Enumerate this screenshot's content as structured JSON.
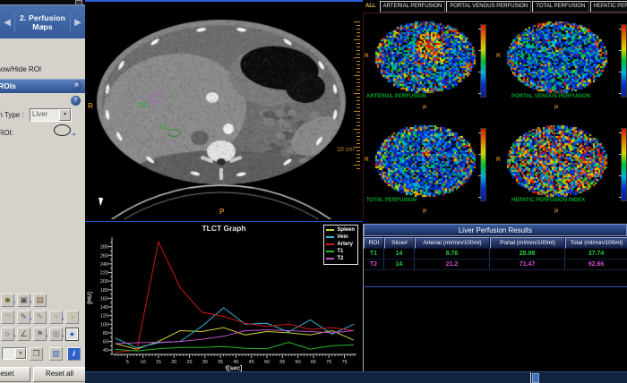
{
  "sidebar": {
    "nav_banner": {
      "title": "2. Perfusion Maps",
      "prev_icon": "◄",
      "next_icon": "►",
      "dropdown_icon": "▼"
    },
    "show_hide_roi_label": "Show/Hide ROI",
    "rois_panel": {
      "title": "ROIs",
      "close_icon": "✕",
      "help_icon": "?",
      "type_label": "Perfusion Type :",
      "type_value": "Liver",
      "tissue_roi_label": "Tissue ROI:"
    },
    "toolbar": {
      "rows": [
        {
          "icons": [
            {
              "name": "protocol-user-icon",
              "glyph": "☻",
              "color": "#6a6f2a",
              "dropdown": true
            },
            {
              "name": "copy-series-icon",
              "glyph": "▣",
              "color": "#555555",
              "dropdown": true
            },
            {
              "name": "report-notebook-icon",
              "glyph": "▤",
              "color": "#7a5a2a",
              "dropdown": false
            }
          ]
        },
        {
          "icons": [
            {
              "name": "tooth-roi-icon",
              "glyph": "◠",
              "color": "#777777",
              "dropdown": false
            },
            {
              "name": "freehand-draw-icon",
              "glyph": "✎",
              "color": "#555555",
              "dropdown": true
            },
            {
              "name": "pencil-roi-icon",
              "glyph": "✎",
              "color": "#888888",
              "dropdown": false
            },
            {
              "name": "seed-point-icon",
              "glyph": "+",
              "color": "#999999",
              "dropdown": true
            },
            {
              "name": "bean-roi-icon",
              "glyph": "◗",
              "color": "#b8a23a",
              "dropdown": false
            }
          ]
        },
        {
          "icons": [
            {
              "name": "circle-roi-icon",
              "glyph": "○",
              "color": "#444444",
              "dropdown": true
            },
            {
              "name": "angle-measure-icon",
              "glyph": "∠",
              "color": "#555555",
              "dropdown": false
            },
            {
              "name": "flag-annotation-icon",
              "glyph": "⚑",
              "color": "#777777",
              "dropdown": true
            },
            {
              "name": "magnify-roi-icon",
              "glyph": "◎",
              "color": "#666666",
              "dropdown": true
            },
            {
              "name": "ellipse-roi-tool-icon",
              "glyph": "●",
              "color": "#2f62c8",
              "active": true,
              "dropdown": false
            }
          ]
        }
      ],
      "combo_row": {
        "combo_dropdown_icon": "▼",
        "copy_icon": "❐",
        "grid_icon": "▥",
        "info_icon": "i"
      }
    },
    "reset_button": "Reset",
    "reset_all_button": "Reset all"
  },
  "ct_view": {
    "orientation_left": "R",
    "orientation_bottom": "P",
    "scale_label": "10 cm",
    "rois": [
      {
        "id": "T1",
        "label": "T1",
        "color": "#2f8e2f"
      },
      {
        "id": "T2",
        "label": "T2",
        "color": "#b05ec0"
      }
    ]
  },
  "maps_panel": {
    "tabs": [
      {
        "label": "ALL",
        "active": true
      },
      {
        "label": "ARTERIAL PERFUSION",
        "active": false
      },
      {
        "label": "PORTAL VENOUS PERFUSION",
        "active": false
      },
      {
        "label": "TOTAL PERFUSION",
        "active": false
      },
      {
        "label": "HEPATIC PERFUSION INDEX",
        "active": false
      }
    ],
    "maps": [
      {
        "id": "arterial",
        "label": "ARTERIAL PERFUSION",
        "orientation_left": "R",
        "orientation_bottom": "P"
      },
      {
        "id": "portal",
        "label": "PORTAL VENOUS PERFUSION",
        "orientation_left": "R",
        "orientation_bottom": "P"
      },
      {
        "id": "total",
        "label": "TOTAL PERFUSION",
        "orientation_left": "R",
        "orientation_bottom": "P"
      },
      {
        "id": "hepatic",
        "label": "HEPATIC PERFUSION INDEX",
        "orientation_left": "R",
        "orientation_bottom": "P"
      }
    ]
  },
  "results_table": {
    "title": "Liver Perfusion Results",
    "columns": [
      "ROI",
      "Slice#",
      "Arterial (ml/min/100ml)",
      "Portal (ml/min/100ml)",
      "Total (ml/min/100ml)"
    ],
    "rows": [
      {
        "roi": "T1",
        "slice": "14",
        "arterial": "8.76",
        "portal": "28.98",
        "total": "37.74",
        "color": "#22cc44",
        "slice_color": "#22cc44"
      },
      {
        "roi": "T2",
        "slice": "14",
        "arterial": "21.2",
        "portal": "71.47",
        "total": "92.66",
        "color": "#d24ad2",
        "slice_color": "#22cc44"
      }
    ]
  },
  "chart_data": {
    "type": "line",
    "title": "TLCT Graph",
    "xlabel": "t[sec]",
    "ylabel": "[HU]",
    "x": [
      1,
      8,
      15,
      22,
      29,
      36,
      43,
      50,
      57,
      64,
      71,
      78
    ],
    "series": [
      {
        "name": "Spleen",
        "color": "#cfcf30",
        "values": [
          55,
          42,
          60,
          85,
          83,
          92,
          75,
          83,
          80,
          75,
          85,
          63
        ]
      },
      {
        "name": "Vein",
        "color": "#30b8d8",
        "values": [
          68,
          45,
          57,
          60,
          95,
          138,
          100,
          102,
          82,
          110,
          77,
          100
        ]
      },
      {
        "name": "Artery",
        "color": "#d01818",
        "values": [
          35,
          40,
          291,
          185,
          128,
          118,
          102,
          95,
          100,
          88,
          92,
          85
        ]
      },
      {
        "name": "T1",
        "color": "#28b828",
        "values": [
          42,
          38,
          43,
          46,
          46,
          48,
          44,
          43,
          58,
          42,
          50,
          52
        ]
      },
      {
        "name": "T2",
        "color": "#c050c0",
        "values": [
          55,
          57,
          58,
          60,
          65,
          72,
          85,
          87,
          85,
          83,
          80,
          85
        ]
      }
    ],
    "ylim": [
      30,
      300
    ],
    "yticks": [
      40,
      60,
      80,
      100,
      120,
      140,
      160,
      180,
      200,
      220,
      240,
      260,
      280
    ],
    "xticks": [
      5,
      10,
      15,
      20,
      25,
      30,
      35,
      40,
      45,
      50,
      55,
      60,
      65,
      70,
      75
    ],
    "grid": false,
    "legend_position": "top-right"
  },
  "colors": {
    "accent_blue": "#2f62d8",
    "annotation_orange": "#c8841e",
    "map_label_green": "#00a428",
    "tab_active_yellow": "#d8c830",
    "t1_green": "#22cc44",
    "t2_magenta": "#d24ad2"
  }
}
